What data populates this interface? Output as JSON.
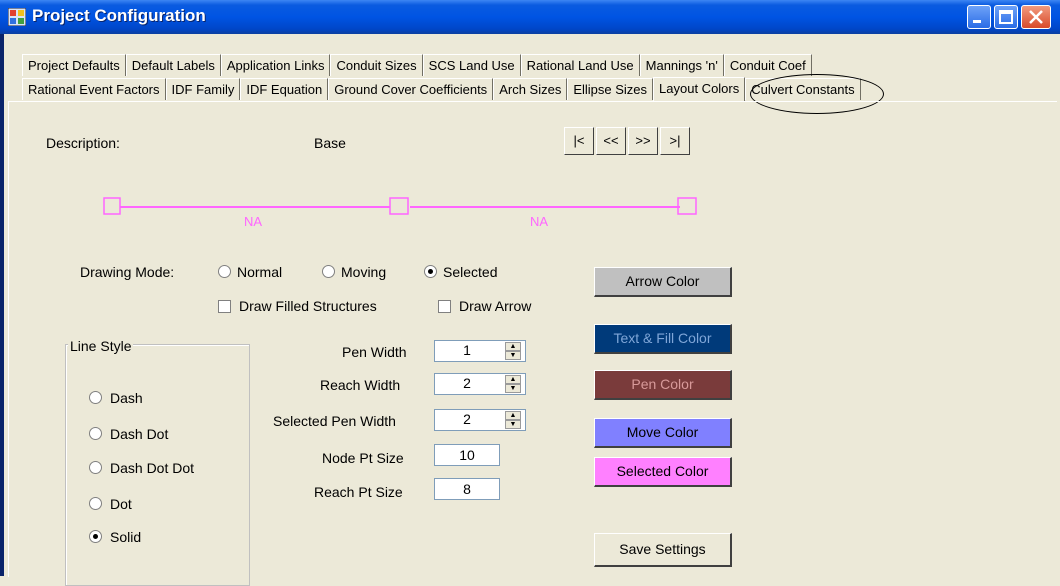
{
  "window": {
    "title": "Project Configuration"
  },
  "tabs_row1": [
    "Project Defaults",
    "Default Labels",
    "Application Links",
    "Conduit Sizes",
    "SCS Land Use",
    "Rational Land Use",
    "Mannings 'n'",
    "Conduit Coef"
  ],
  "tabs_row2": [
    "Rational Event Factors",
    "IDF Family",
    "IDF Equation",
    "Ground Cover Coefficients",
    "Arch Sizes",
    "Ellipse Sizes",
    "Layout Colors",
    "Culvert Constants"
  ],
  "description": {
    "label": "Description:",
    "value": "Base"
  },
  "nav": {
    "first": "|<",
    "prev": "<<",
    "next": ">>",
    "last": ">|"
  },
  "preview": {
    "label1": "NA",
    "label2": "NA",
    "line_color": "#ff66ff"
  },
  "drawing_mode": {
    "label": "Drawing Mode:",
    "options": [
      "Normal",
      "Moving",
      "Selected"
    ],
    "selected": "Selected"
  },
  "checkboxes": {
    "draw_filled": "Draw Filled Structures",
    "draw_arrow": "Draw Arrow"
  },
  "line_style": {
    "title": "Line Style",
    "options": [
      "Dash",
      "Dash Dot",
      "Dash Dot Dot",
      "Dot",
      "Solid"
    ],
    "selected": "Solid"
  },
  "settings": {
    "pen_width": {
      "label": "Pen Width",
      "value": "1"
    },
    "reach_width": {
      "label": "Reach Width",
      "value": "2"
    },
    "selected_pen_width": {
      "label": "Selected Pen Width",
      "value": "2"
    },
    "node_pt_size": {
      "label": "Node Pt Size",
      "value": "10"
    },
    "reach_pt_size": {
      "label": "Reach Pt Size",
      "value": "8"
    }
  },
  "color_buttons": {
    "arrow": {
      "label": "Arrow Color",
      "color": "#c0c0c0"
    },
    "text_fill": {
      "label": "Text & Fill Color",
      "color": "#003a7a"
    },
    "pen": {
      "label": "Pen Color",
      "color": "#7a3b3b"
    },
    "move": {
      "label": "Move Color",
      "color": "#8080ff"
    },
    "selected": {
      "label": "Selected Color",
      "color": "#ff80ff"
    }
  },
  "save_label": "Save Settings"
}
